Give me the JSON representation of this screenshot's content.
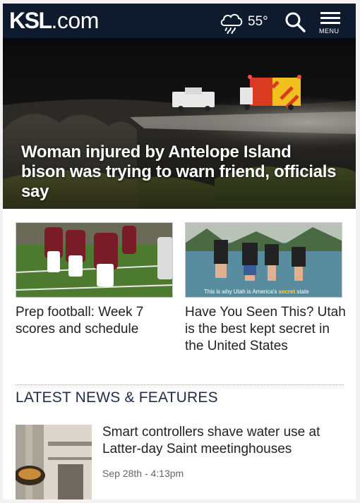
{
  "header": {
    "logo_main": "KSL",
    "logo_suffix": ".com",
    "weather_icon": "rain-cloud-icon",
    "temperature": "55°",
    "search_icon": "search-icon",
    "menu_label": "MENU",
    "background_color": "#0e1b2e"
  },
  "hero": {
    "headline": "Woman injured by Antelope Island bison was trying to warn friend, officials say"
  },
  "cards": [
    {
      "title": "Prep football: Week 7 scores and schedule"
    },
    {
      "title": "Have You Seen This? Utah is the best kept secret in the United States",
      "caption_prefix": "This is why Utah is America's ",
      "caption_highlight": "secret",
      "caption_suffix": " state"
    }
  ],
  "section": {
    "title": "LATEST NEWS & FEATURES",
    "color": "#1f2c48"
  },
  "news": [
    {
      "title": "Smart controllers shave water use at Latter-day Saint meetinghouses",
      "date": "Sep 28th - 4:13pm"
    }
  ]
}
